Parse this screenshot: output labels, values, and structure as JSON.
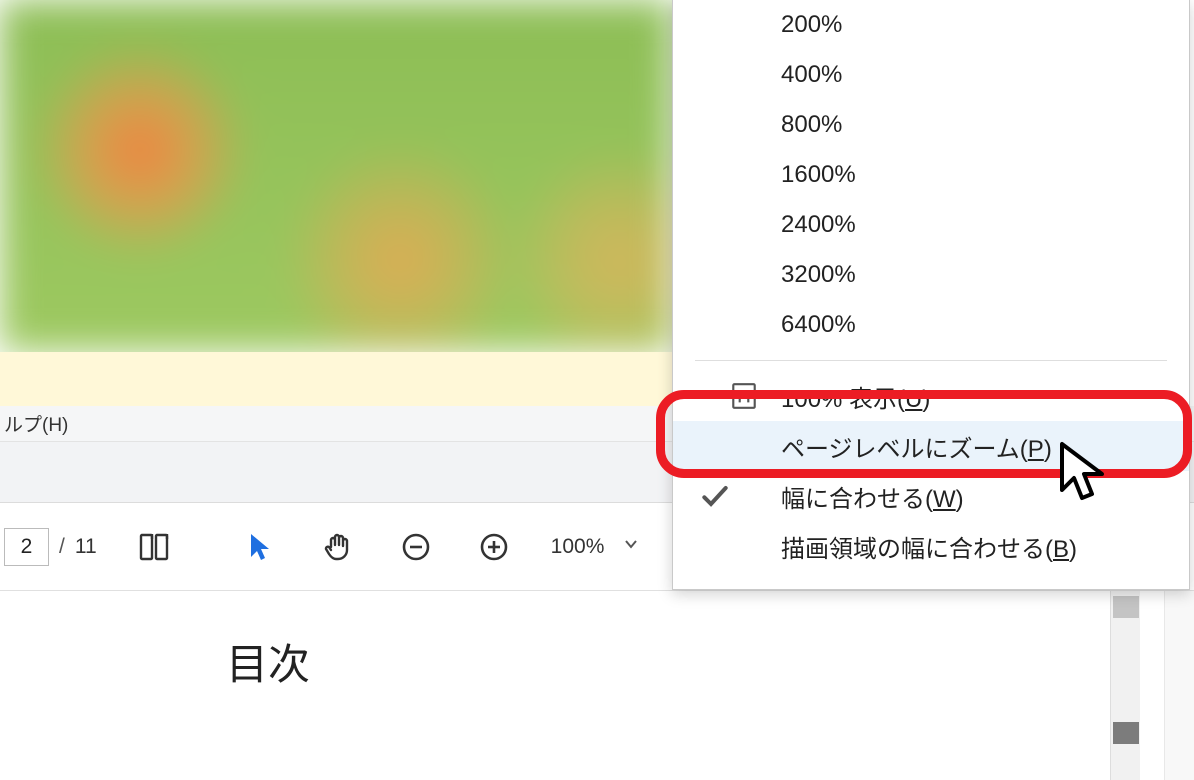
{
  "menubar": {
    "help_label": "ルプ(H)"
  },
  "toolbar": {
    "page_current": "2",
    "page_separator": "/",
    "page_total": "11",
    "zoom_value": "100%"
  },
  "document": {
    "heading": "目次"
  },
  "zoom_menu": {
    "percent_items": [
      "200%",
      "400%",
      "800%",
      "1600%",
      "2400%",
      "3200%",
      "6400%"
    ],
    "actual_size": {
      "label": "100% 表示(",
      "hotkey": "U",
      "close": ")"
    },
    "fit_page": {
      "label": "ページレベルにズーム(",
      "hotkey": "P",
      "close": ")"
    },
    "fit_width": {
      "label": "幅に合わせる(",
      "hotkey": "W",
      "close": ")"
    },
    "fit_visible": {
      "label": "描画領域の幅に合わせる(",
      "hotkey": "B",
      "close": ")"
    }
  }
}
